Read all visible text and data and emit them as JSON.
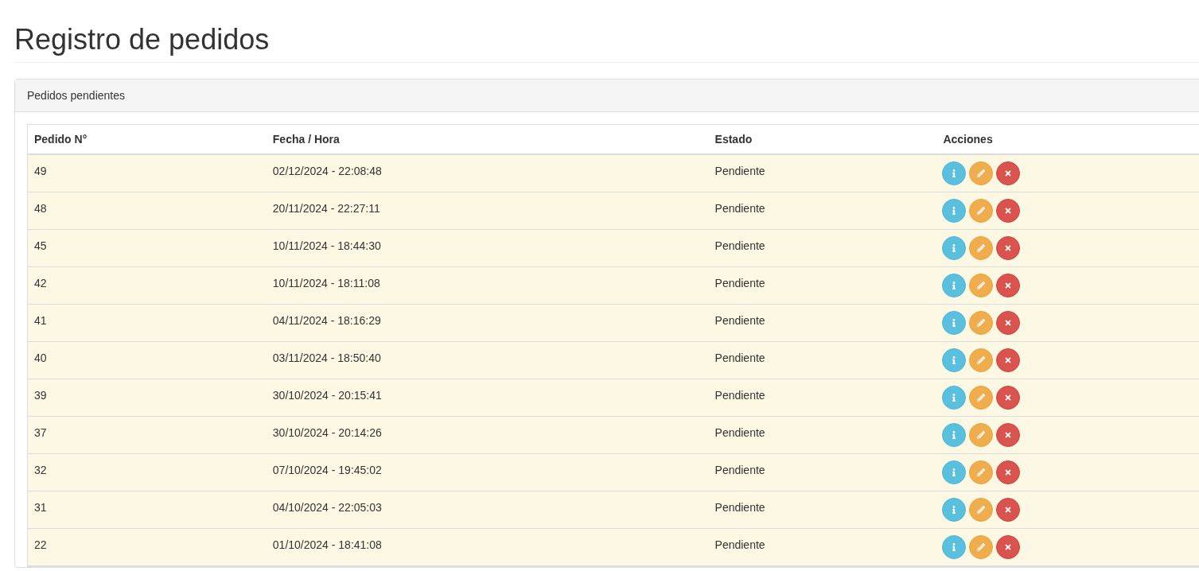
{
  "page_title": "Registro de pedidos",
  "panel": {
    "title": "Pedidos pendientes",
    "table": {
      "columns": [
        "Pedido N°",
        "Fecha / Hora",
        "Estado",
        "Acciones"
      ],
      "rows": [
        {
          "id": "49",
          "datetime": "02/12/2024 - 22:08:48",
          "status": "Pendiente"
        },
        {
          "id": "48",
          "datetime": "20/11/2024 - 22:27:11",
          "status": "Pendiente"
        },
        {
          "id": "45",
          "datetime": "10/11/2024 - 18:44:30",
          "status": "Pendiente"
        },
        {
          "id": "42",
          "datetime": "10/11/2024 - 18:11:08",
          "status": "Pendiente"
        },
        {
          "id": "41",
          "datetime": "04/11/2024 - 18:16:29",
          "status": "Pendiente"
        },
        {
          "id": "40",
          "datetime": "03/11/2024 - 18:50:40",
          "status": "Pendiente"
        },
        {
          "id": "39",
          "datetime": "30/10/2024 - 20:15:41",
          "status": "Pendiente"
        },
        {
          "id": "37",
          "datetime": "30/10/2024 - 20:14:26",
          "status": "Pendiente"
        },
        {
          "id": "32",
          "datetime": "07/10/2024 - 19:45:02",
          "status": "Pendiente"
        },
        {
          "id": "31",
          "datetime": "04/10/2024 - 22:05:03",
          "status": "Pendiente"
        },
        {
          "id": "22",
          "datetime": "01/10/2024 - 18:41:08",
          "status": "Pendiente"
        }
      ]
    }
  }
}
